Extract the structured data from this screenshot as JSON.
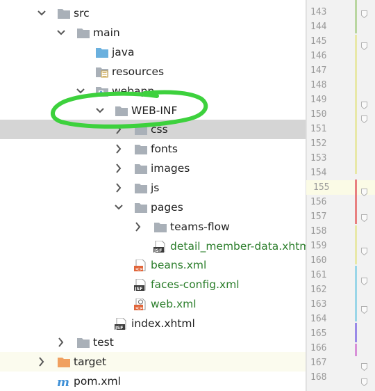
{
  "tree": {
    "items": [
      {
        "label": "src",
        "icon": "folder-icon",
        "arrow": "expanded"
      },
      {
        "label": "main",
        "icon": "folder-icon",
        "arrow": "expanded"
      },
      {
        "label": "java",
        "icon": "source-folder-icon",
        "arrow": "none"
      },
      {
        "label": "resources",
        "icon": "resources-folder-icon",
        "arrow": "none"
      },
      {
        "label": "webapp",
        "icon": "web-folder-icon",
        "arrow": "expanded"
      },
      {
        "label": "WEB-INF",
        "icon": "folder-icon",
        "arrow": "expanded"
      },
      {
        "label": "css",
        "icon": "folder-icon",
        "arrow": "collapsed"
      },
      {
        "label": "fonts",
        "icon": "folder-icon",
        "arrow": "collapsed"
      },
      {
        "label": "images",
        "icon": "folder-icon",
        "arrow": "collapsed"
      },
      {
        "label": "js",
        "icon": "folder-icon",
        "arrow": "collapsed"
      },
      {
        "label": "pages",
        "icon": "folder-icon",
        "arrow": "expanded"
      },
      {
        "label": "teams-flow",
        "icon": "folder-icon",
        "arrow": "collapsed"
      },
      {
        "label": "detail_member-data.xhtml",
        "icon": "jsf-file-icon",
        "arrow": "none"
      },
      {
        "label": "beans.xml",
        "icon": "xml-file-icon",
        "arrow": "none"
      },
      {
        "label": "faces-config.xml",
        "icon": "jsf-file-icon",
        "arrow": "none"
      },
      {
        "label": "web.xml",
        "icon": "web-xml-file-icon",
        "arrow": "none"
      },
      {
        "label": "index.xhtml",
        "icon": "jsf-file-icon",
        "arrow": "none"
      },
      {
        "label": "test",
        "icon": "folder-icon",
        "arrow": "collapsed"
      },
      {
        "label": "target",
        "icon": "excluded-folder-icon",
        "arrow": "collapsed"
      },
      {
        "label": "pom.xml",
        "icon": "maven-icon",
        "arrow": "none"
      }
    ]
  },
  "gutter": {
    "line_numbers": [
      "143",
      "144",
      "145",
      "146",
      "147",
      "148",
      "149",
      "150",
      "151",
      "152",
      "153",
      "154",
      "155",
      "156",
      "157",
      "158",
      "159",
      "160",
      "161",
      "162",
      "163",
      "164",
      "165",
      "166",
      "167",
      "168"
    ],
    "current_line": "155"
  },
  "colors": {
    "folder": "#a9b0b8",
    "source_folder": "#6ab0de",
    "excluded_folder": "#f0a060",
    "green_text": "#2a7d2a",
    "selection": "#d5d5d5",
    "scribble": "#3dd13d"
  }
}
